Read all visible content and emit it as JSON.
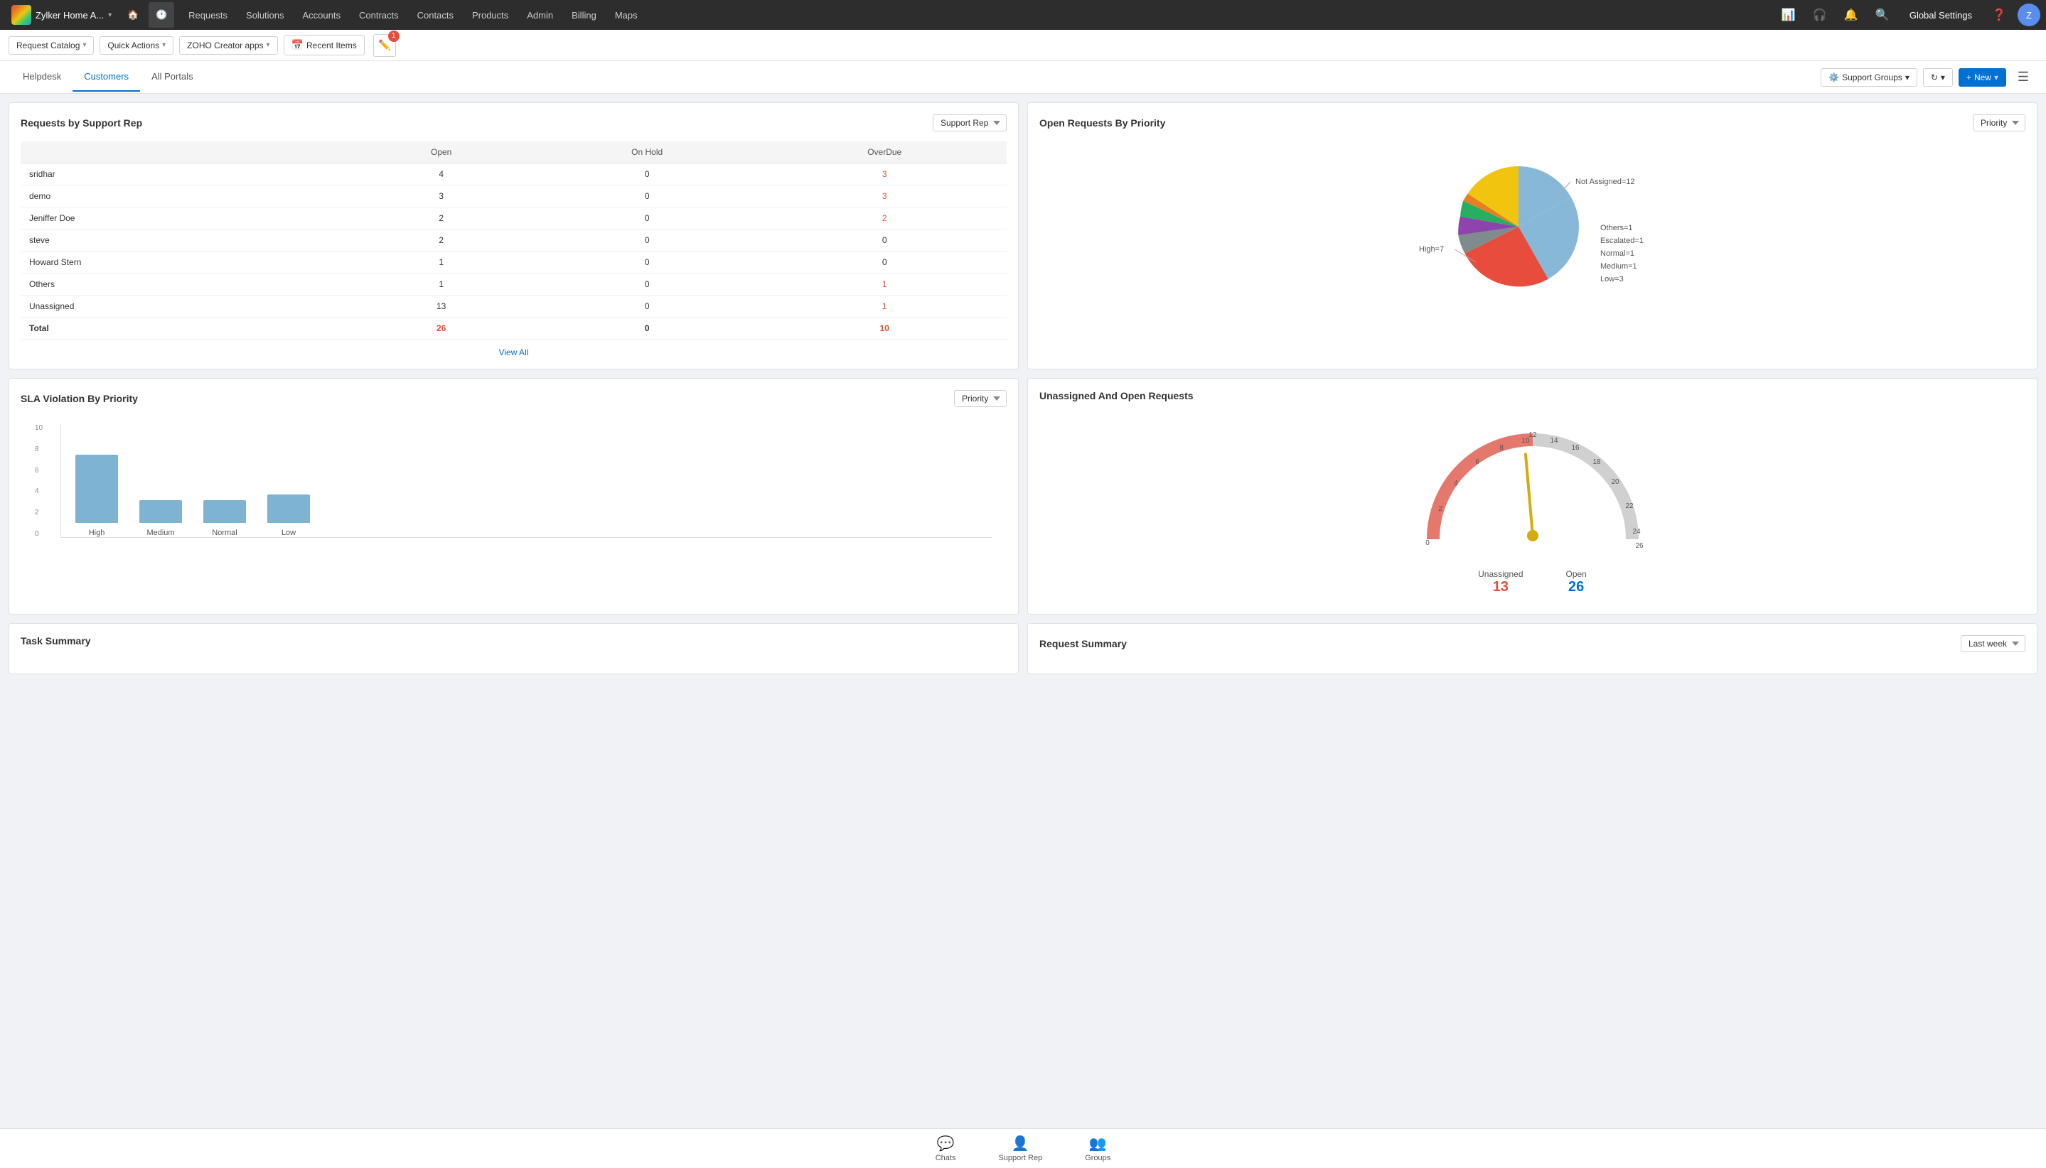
{
  "app": {
    "name": "Zylker Home A...",
    "logo_alt": "Zoho logo"
  },
  "topnav": {
    "items": [
      "Requests",
      "Solutions",
      "Accounts",
      "Contracts",
      "Contacts",
      "Products",
      "Admin",
      "Billing",
      "Maps"
    ],
    "global_settings": "Global Settings"
  },
  "toolbar": {
    "request_catalog": "Request Catalog",
    "quick_actions": "Quick Actions",
    "zoho_creator": "ZOHO Creator apps",
    "recent_items": "Recent Items",
    "notif_count": "1"
  },
  "tabs": {
    "items": [
      "Helpdesk",
      "Customers",
      "All Portals"
    ],
    "active": "Customers",
    "support_groups": "Support Groups",
    "new": "New",
    "breadcrumb": "Customers"
  },
  "requests_by_support_rep": {
    "title": "Requests by Support Rep",
    "dropdown": "Support Rep",
    "columns": [
      "",
      "Open",
      "On Hold",
      "OverDue"
    ],
    "rows": [
      {
        "name": "sridhar",
        "open": "4",
        "onhold": "0",
        "overdue": "3",
        "overdue_red": true
      },
      {
        "name": "demo",
        "open": "3",
        "onhold": "0",
        "overdue": "3",
        "overdue_red": true
      },
      {
        "name": "Jeniffer Doe",
        "open": "2",
        "onhold": "0",
        "overdue": "2",
        "overdue_red": true
      },
      {
        "name": "steve",
        "open": "2",
        "onhold": "0",
        "overdue": "0",
        "overdue_red": false
      },
      {
        "name": "Howard Stern",
        "open": "1",
        "onhold": "0",
        "overdue": "0",
        "overdue_red": false
      },
      {
        "name": "Others",
        "open": "1",
        "onhold": "0",
        "overdue": "1",
        "overdue_red": true
      },
      {
        "name": "Unassigned",
        "open": "13",
        "onhold": "0",
        "overdue": "1",
        "overdue_red": true
      }
    ],
    "total": {
      "name": "Total",
      "open": "26",
      "onhold": "0",
      "overdue": "10"
    },
    "view_all": "View All"
  },
  "open_requests_by_priority": {
    "title": "Open Requests By Priority",
    "dropdown": "Priority",
    "legend": [
      {
        "label": "Not Assigned=12",
        "color": "#87b8d8"
      },
      {
        "label": "High=7",
        "color": "#e74c3c"
      },
      {
        "label": "Others=1",
        "color": "#7f8c8d"
      },
      {
        "label": "Escalated=1",
        "color": "#8e44ad"
      },
      {
        "label": "Normal=1",
        "color": "#27ae60"
      },
      {
        "label": "Medium=1",
        "color": "#e67e22"
      },
      {
        "label": "Low=3",
        "color": "#f1c40f"
      }
    ]
  },
  "sla_violation": {
    "title": "SLA Violation By Priority",
    "dropdown": "Priority",
    "y_labels": [
      "10",
      "8",
      "6",
      "4",
      "2",
      "0"
    ],
    "bars": [
      {
        "label": "High",
        "value": 6,
        "height": 96
      },
      {
        "label": "Medium",
        "value": 2,
        "height": 32
      },
      {
        "label": "Normal",
        "value": 2,
        "height": 32
      },
      {
        "label": "Low",
        "value": 2.5,
        "height": 40
      }
    ]
  },
  "unassigned_open": {
    "title": "Unassigned And Open Requests",
    "gauge_max": 26,
    "unassigned": {
      "label": "Unassigned",
      "value": "13",
      "color": "red"
    },
    "open": {
      "label": "Open",
      "value": "26",
      "color": "blue"
    },
    "tick_labels": [
      "0",
      "2",
      "4",
      "6",
      "8",
      "10",
      "12",
      "14",
      "16",
      "18",
      "20",
      "22",
      "24",
      "26"
    ]
  },
  "task_summary": {
    "title": "Task Summary"
  },
  "request_summary": {
    "title": "Request Summary",
    "dropdown": "Last week"
  },
  "bottom_bar": {
    "items": [
      {
        "label": "Chats",
        "icon": "💬"
      },
      {
        "label": "Support Rep",
        "icon": "👤"
      },
      {
        "label": "Groups",
        "icon": "👥"
      }
    ]
  }
}
